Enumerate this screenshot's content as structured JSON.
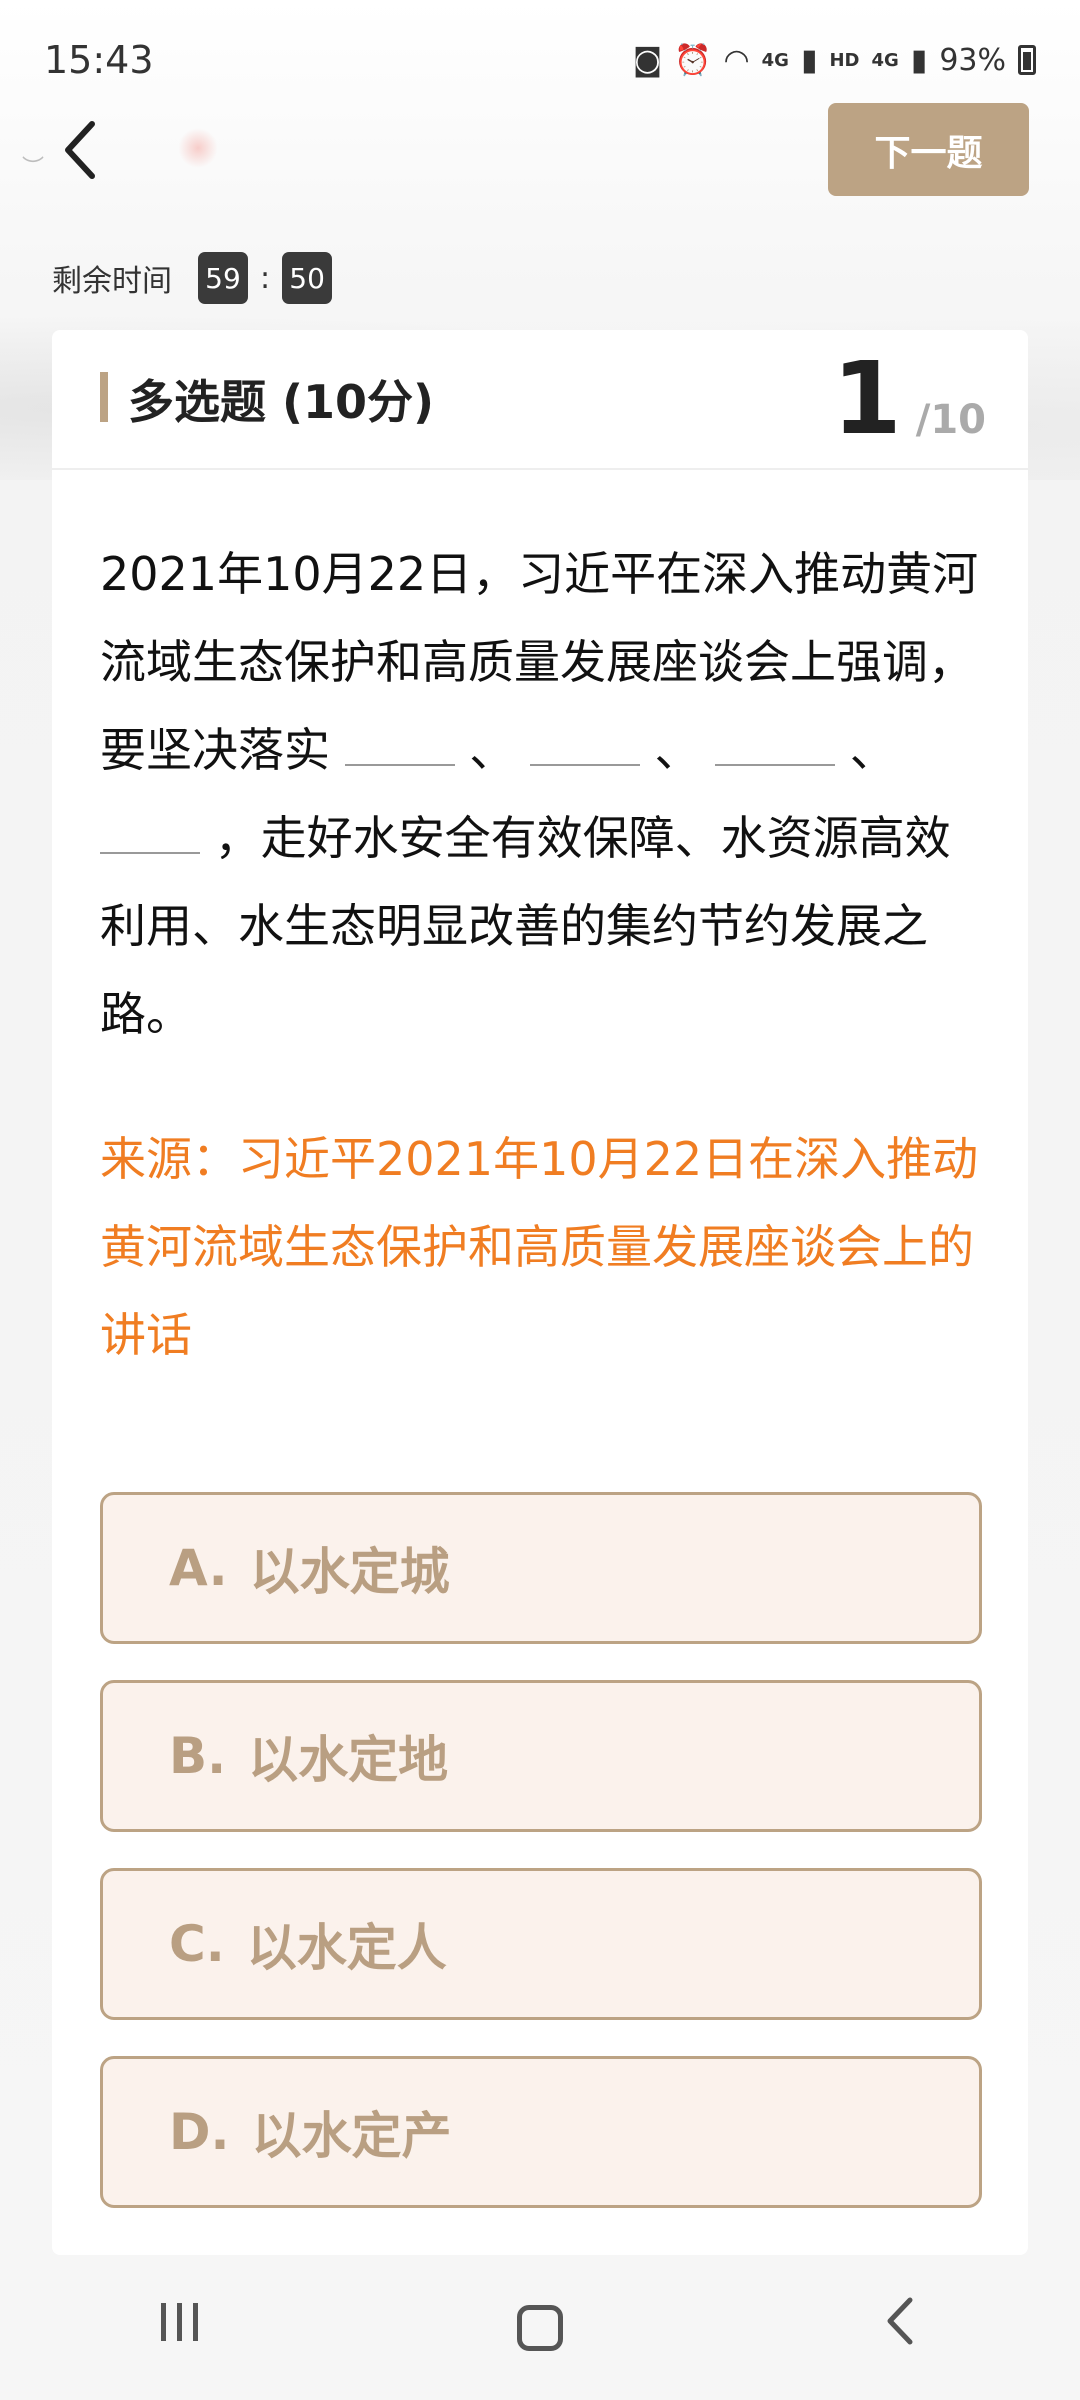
{
  "status_bar": {
    "time": "15:43",
    "battery": "93%",
    "network1": "4G",
    "network2": "4G",
    "hd": "HD"
  },
  "header": {
    "back_icon": "chevron-left-icon",
    "next_label": "下一题"
  },
  "timer": {
    "label": "剩余时间",
    "minutes": "59",
    "separator": ":",
    "seconds": "50"
  },
  "question_card": {
    "type_label": "多选题 (10分)",
    "current_number": "1",
    "total": "/10",
    "text_part1": "2021年10月22日，习近平在深入推动黄河流域生态保护和高质量发展座谈会上强调，要坚决落实",
    "text_sep": "、",
    "text_part2": "，走好水安全有效保障、水资源高效利用、水生态明显改善的集约节约发展之路。",
    "source": "来源：习近平2021年10月22日在深入推动黄河流域生态保护和高质量发展座谈会上的讲话"
  },
  "options": [
    {
      "letter": "A.",
      "text": "以水定城"
    },
    {
      "letter": "B.",
      "text": "以水定地"
    },
    {
      "letter": "C.",
      "text": "以水定人"
    },
    {
      "letter": "D.",
      "text": "以水定产"
    }
  ],
  "colors": {
    "accent": "#bca384",
    "source_text": "#f07d22",
    "option_bg": "#fbf2ec"
  },
  "navbar": {
    "recents_icon": "recents-icon",
    "home_icon": "home-icon",
    "back_icon": "back-icon"
  }
}
